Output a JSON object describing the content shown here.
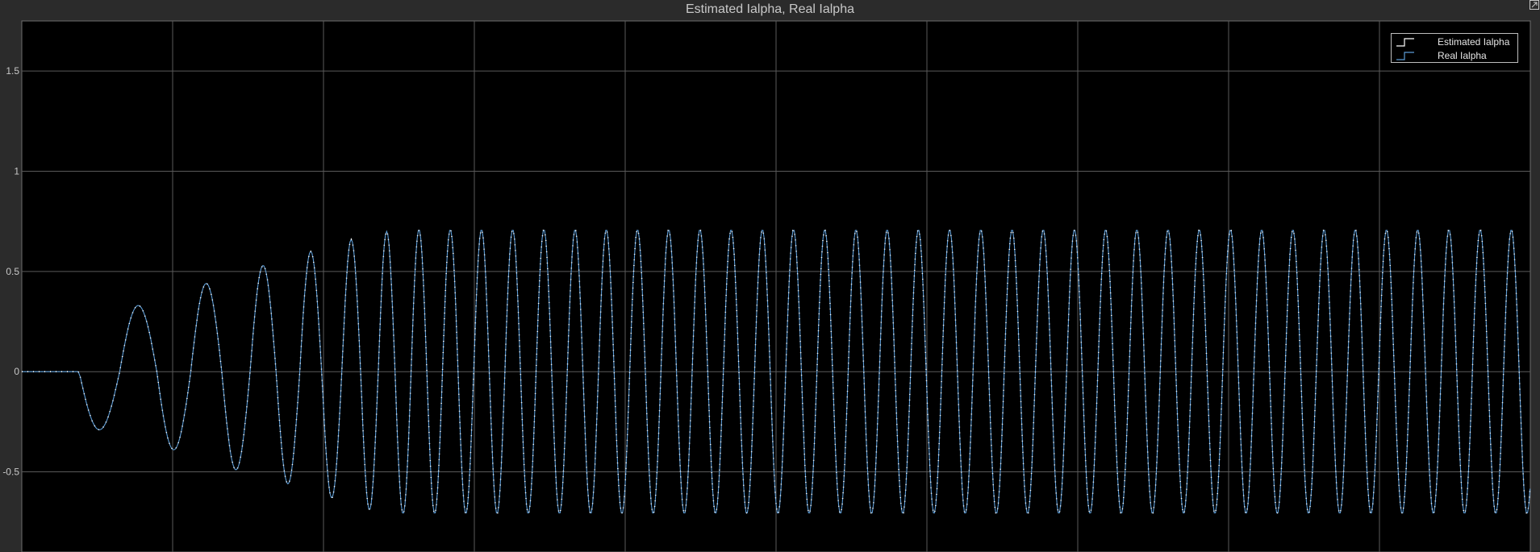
{
  "window": {
    "title": "Estimated Ialpha, Real Ialpha",
    "background": "#2b2b2b",
    "plot_background": "#000000",
    "grid_color": "#5a5a5a"
  },
  "legend": {
    "placement": "top-right",
    "entries": [
      {
        "label": "Estimated Ialpha",
        "color": "#ffffff",
        "icon": "step-line-icon"
      },
      {
        "label": "Real Ialpha",
        "color": "#5b9bd5",
        "icon": "step-line-icon"
      }
    ]
  },
  "chart_data": {
    "type": "line",
    "title": "Estimated Ialpha, Real Ialpha",
    "xlabel": "",
    "ylabel": "",
    "ylim": [
      -0.9,
      1.75
    ],
    "yticks": [
      -0.5,
      0,
      0.5,
      1,
      1.5
    ],
    "ytick_labels": [
      "-0.5",
      "0",
      "0.5",
      "1",
      "1.5"
    ],
    "xtick_labels": [],
    "xgrid_divisions": 10,
    "grid": true,
    "series": [
      {
        "name": "Estimated Ialpha",
        "color": "#ffffff",
        "signal": {
          "flat_until_cycles": 0,
          "cycle_peaks": [
            0.0,
            -0.29,
            0.33,
            -0.39,
            0.44,
            -0.49,
            0.53,
            -0.56,
            0.6,
            -0.63,
            0.66,
            -0.69,
            0.7,
            -0.71,
            0.71
          ],
          "steady_amplitude": 0.71,
          "total_cycles": 46.5
        }
      },
      {
        "name": "Real Ialpha",
        "color": "#5b9bd5",
        "signal": {
          "flat_until_cycles": 0,
          "cycle_peaks": [
            0.0,
            -0.29,
            0.33,
            -0.39,
            0.44,
            -0.49,
            0.53,
            -0.56,
            0.6,
            -0.63,
            0.66,
            -0.69,
            0.7,
            -0.71,
            0.71
          ],
          "steady_amplitude": 0.71,
          "total_cycles": 46.5
        }
      }
    ]
  }
}
